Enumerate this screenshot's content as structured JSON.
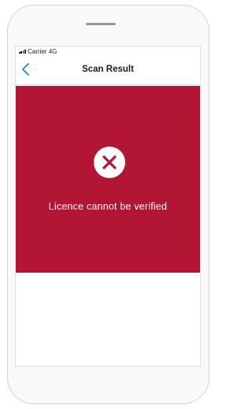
{
  "status_bar": {
    "carrier": "Carrier",
    "network": "4G"
  },
  "nav": {
    "title": "Scan Result",
    "back_icon": "chevron-left-icon"
  },
  "result": {
    "message": "Licence cannot be verified",
    "icon": "close-circle-icon",
    "panel_color": "#b21634"
  }
}
